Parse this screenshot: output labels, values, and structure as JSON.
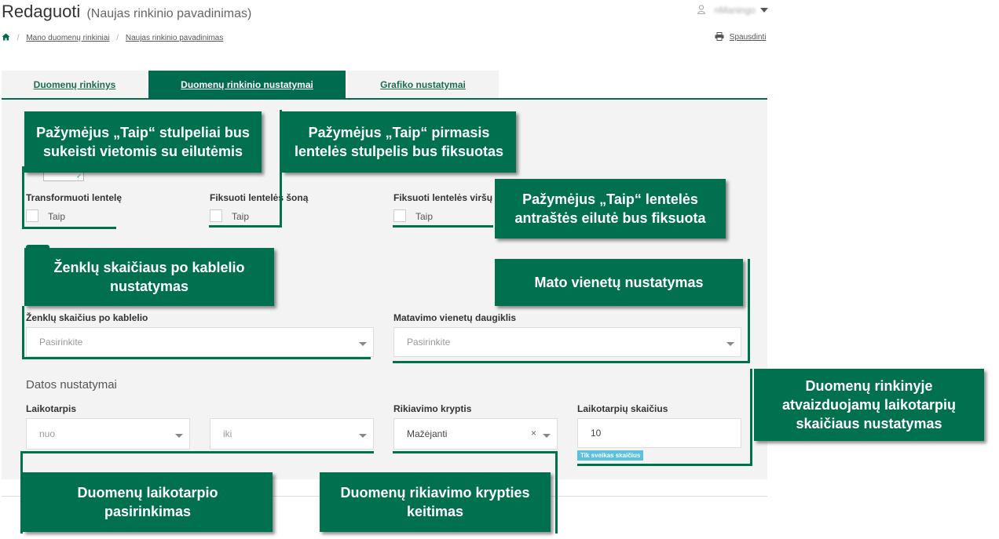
{
  "header": {
    "title": "Redaguoti",
    "subtitle": "(Naujas rinkinio pavadinimas)",
    "user_icon": "user-icon",
    "user_name": "nManingo"
  },
  "breadcrumb": {
    "home_icon": "home-icon",
    "items": [
      "Mano duomenų rinkiniai",
      "Naujas rinkinio pavadinimas"
    ]
  },
  "print": {
    "icon": "printer-icon",
    "label": "Spausdinti"
  },
  "tabs": [
    {
      "label": "Duomenų rinkinys",
      "active": false
    },
    {
      "label": "Duomenų rinkinio nustatymai",
      "active": true
    },
    {
      "label": "Grafiko nustatymai",
      "active": false
    }
  ],
  "settings": {
    "transform": {
      "label": "Transformuoti lentelę",
      "option": "Taip",
      "checked": false
    },
    "fix_side": {
      "label": "Fiksuoti lentelės šoną",
      "option": "Taip",
      "checked": false
    },
    "fix_top": {
      "label": "Fiksuoti lentelės viršų",
      "option": "Taip",
      "checked": false
    },
    "decimals": {
      "label": "Ženklų skaičius po kablelio",
      "placeholder": "Pasirinkite"
    },
    "units": {
      "label": "Matavimo vienetų daugiklis",
      "placeholder": "Pasirinkite"
    }
  },
  "date_settings": {
    "heading": "Datos nustatymai",
    "period": {
      "label": "Laikotarpis",
      "from_placeholder": "nuo",
      "to_placeholder": "iki"
    },
    "sort": {
      "label": "Rikiavimo kryptis",
      "value": "Mažėjanti",
      "clear": "×"
    },
    "count": {
      "label": "Laikotarpių skaičius",
      "value": "10",
      "hint": "Tik sveikas skaičius"
    }
  },
  "callouts": {
    "transform": [
      "Pažymėjus „Taip“ stulpeliai bus",
      "sukeisti vietomis su eilutėmis"
    ],
    "fix_side": [
      "Pažymėjus „Taip“ pirmasis",
      "lentelės stulpelis bus fiksuotas"
    ],
    "fix_top": [
      "Pažymėjus „Taip“ lentelės",
      "antraštės eilutė bus fiksuota"
    ],
    "decimals": [
      "Ženklų skaičiaus po kablelio",
      "nustatymas"
    ],
    "units": [
      "Mato vienetų nustatymas"
    ],
    "count": [
      "Duomenų rinkinyje",
      "atvaizduojamų laikotarpių",
      "skaičiaus nustatymas"
    ],
    "period": [
      "Duomenų laikotarpio",
      "pasirinkimas"
    ],
    "sort": [
      "Duomenų rikiavimo krypties",
      "keitimas"
    ]
  },
  "colors": {
    "brand_green": "#006b4f",
    "panel_bg": "#f3f3f3",
    "badge": "#5bc0de"
  }
}
